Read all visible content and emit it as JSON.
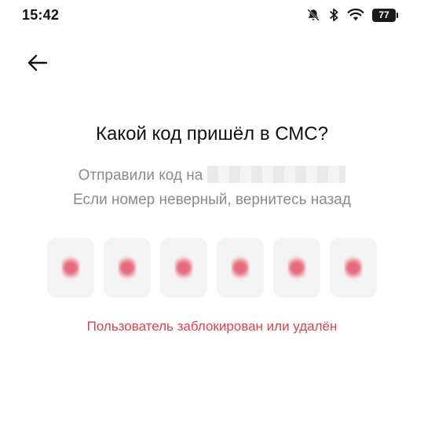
{
  "status_bar": {
    "time": "15:42",
    "battery_level": "77",
    "icons": [
      "bell-muted-icon",
      "bluetooth-icon",
      "wifi-icon",
      "battery-icon"
    ]
  },
  "header": {
    "back_icon": "arrow-left-icon"
  },
  "main": {
    "title": "Какой код пришёл в СМС?",
    "subtitle_line1": "Отправили код на",
    "subtitle_line2": "Если номер неверный, вернитесь назад",
    "code_length": 6,
    "error": "Пользователь заблокирован или удалён"
  },
  "colors": {
    "error": "#d9434d",
    "box_bg": "#f3f3f3",
    "digit_tint": "#e46a7b",
    "muted_text": "#8a8a8a"
  }
}
